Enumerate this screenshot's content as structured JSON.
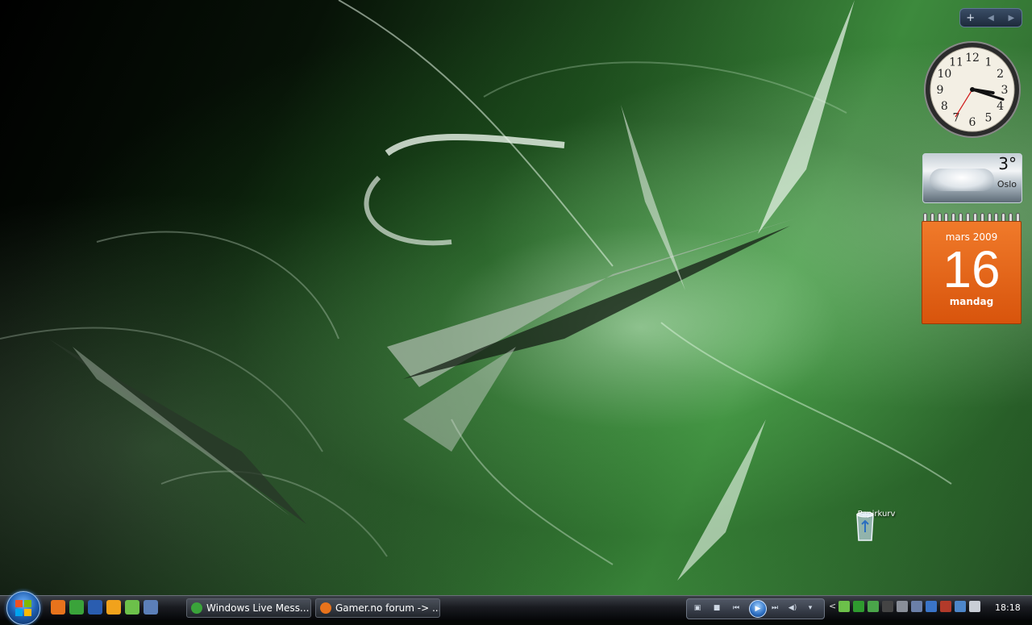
{
  "gadgets": {
    "sidebar_controls": {
      "add": "+",
      "prev": "◀",
      "next": "▶"
    },
    "clock": {
      "numbers": [
        "12",
        "1",
        "2",
        "3",
        "4",
        "5",
        "6",
        "7",
        "8",
        "9",
        "10",
        "11"
      ],
      "hour": 3,
      "minute": 18
    },
    "weather": {
      "temperature": "3°",
      "city": "Oslo"
    },
    "calendar": {
      "month_year": "mars 2009",
      "day": "16",
      "weekday": "mandag"
    }
  },
  "desktop_icons": [
    {
      "label": "Papirkurv",
      "icon": "recycle-bin-icon"
    }
  ],
  "taskbar": {
    "start_icon": "windows-logo-icon",
    "quick_launch": [
      {
        "icon": "firefox-icon",
        "color": "#e8731c"
      },
      {
        "icon": "messenger-icon",
        "color": "#3aa33a"
      },
      {
        "icon": "word-icon",
        "color": "#2a5db0"
      },
      {
        "icon": "media-player-icon",
        "color": "#f1a21c"
      },
      {
        "icon": "spotify-icon",
        "color": "#6cc04a"
      },
      {
        "icon": "editor-icon",
        "color": "#5c7fb8"
      }
    ],
    "tasks": [
      {
        "label": "Windows Live Mess...",
        "icon": "messenger-icon",
        "color": "#3aa33a"
      },
      {
        "label": "Gamer.no forum -> ...",
        "icon": "firefox-icon",
        "color": "#e8731c"
      }
    ],
    "tray_icons": [
      {
        "icon": "spotify-tray-icon",
        "color": "#6cc04a"
      },
      {
        "icon": "h-tray-icon",
        "color": "#2f9a2f"
      },
      {
        "icon": "messenger-tray-icon",
        "color": "#4aa54a"
      },
      {
        "icon": "steam-tray-icon",
        "color": "#444444"
      },
      {
        "icon": "network-signal-icon",
        "color": "#8a8f99"
      },
      {
        "icon": "display-icon",
        "color": "#6b7fa8"
      },
      {
        "icon": "antivirus-icon",
        "color": "#3a74c8"
      },
      {
        "icon": "safely-remove-icon",
        "color": "#b23a2a"
      },
      {
        "icon": "network-icon",
        "color": "#4d86c9"
      },
      {
        "icon": "volume-icon",
        "color": "#c9ced6"
      }
    ],
    "clock_time": "18:18"
  }
}
